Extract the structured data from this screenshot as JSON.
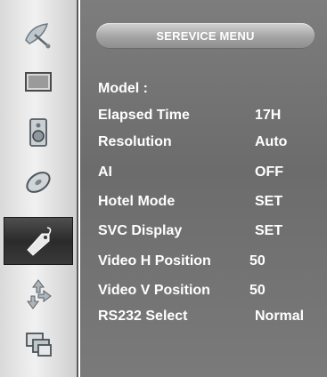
{
  "sidebar": {
    "items": [
      {
        "icon": "satellite-dish-icon",
        "active": false
      },
      {
        "icon": "screen-icon",
        "active": false
      },
      {
        "icon": "speaker-icon",
        "active": false
      },
      {
        "icon": "disc-icon",
        "active": false
      },
      {
        "icon": "tag-icon",
        "active": true
      },
      {
        "icon": "arrows-icon",
        "active": false
      },
      {
        "icon": "windows-icon",
        "active": false
      }
    ]
  },
  "menu": {
    "title": "SEREVICE MENU",
    "rows": [
      {
        "label": "Model :",
        "value": ""
      },
      {
        "label": "Elapsed Time",
        "value": "17H"
      },
      {
        "label": "Resolution",
        "value": "Auto"
      },
      {
        "label": "AI",
        "value": "OFF"
      },
      {
        "label": "Hotel Mode",
        "value": "SET"
      },
      {
        "label": "SVC Display",
        "value": "SET"
      },
      {
        "label": "Video H Position",
        "value": "50"
      },
      {
        "label": "Video V Position",
        "value": "50"
      },
      {
        "label": "RS232 Select",
        "value": "Normal"
      }
    ]
  },
  "colors": {
    "panel": "#727272",
    "text": "#ffffff",
    "active_item": "#2f2f2f"
  }
}
